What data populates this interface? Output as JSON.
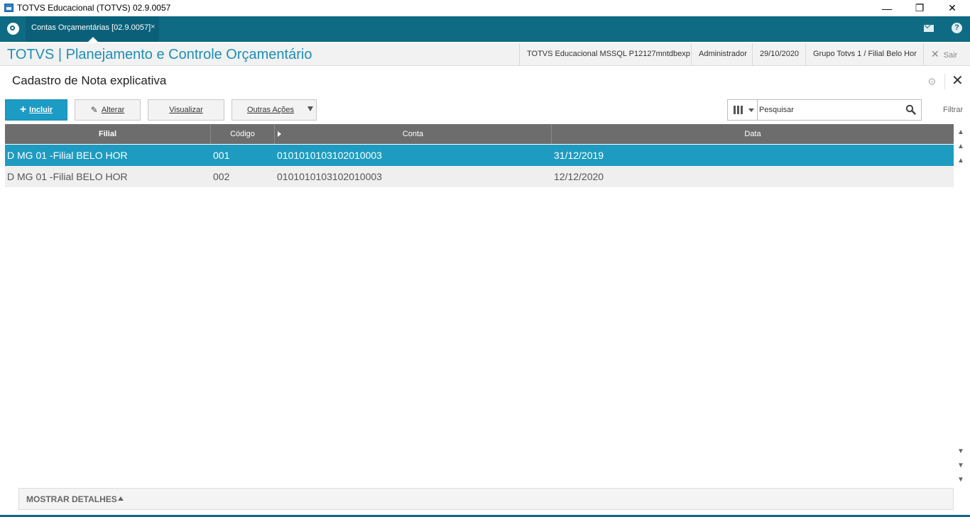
{
  "window": {
    "title": "TOTVS Educacional (TOTVS) 02.9.0057",
    "minimize": "—",
    "restore": "❐",
    "close": "✕"
  },
  "tabs": [
    {
      "label": "Contas Orçamentárias [02.9.0057]",
      "close": "×"
    }
  ],
  "header": {
    "app_title": "TOTVS | Planejamento e Controle Orçamentário",
    "environment": "TOTVS Educacional MSSQL P12127mntdbexp",
    "user": "Administrador",
    "date": "29/10/2020",
    "branch": "Grupo Totvs 1 / Filial Belo Hor",
    "logout": "Sair"
  },
  "page": {
    "title": "Cadastro de Nota explicativa"
  },
  "toolbar": {
    "incluir": "Incluir",
    "alterar": "Alterar",
    "visualizar": "Visualizar",
    "outras_acoes": "Outras Ações"
  },
  "search": {
    "placeholder": "Pesquisar",
    "filter_label": "Filtrar"
  },
  "grid": {
    "columns": [
      "Filial",
      "Código",
      "Conta",
      "Data"
    ],
    "rows": [
      {
        "filial": "D MG 01 -Filial BELO HOR",
        "codigo": "001",
        "conta": "0101010103102010003",
        "data": "31/12/2019"
      },
      {
        "filial": "D MG 01 -Filial BELO HOR",
        "codigo": "002",
        "conta": "0101010103102010003",
        "data": "12/12/2020"
      }
    ]
  },
  "footer": {
    "details_label": "MOSTRAR DETALHES"
  },
  "colors": {
    "teal": "#0e6b83",
    "accent": "#1c9bc4",
    "selected_row": "#1e9bc0",
    "grid_header": "#6d6d6d"
  }
}
